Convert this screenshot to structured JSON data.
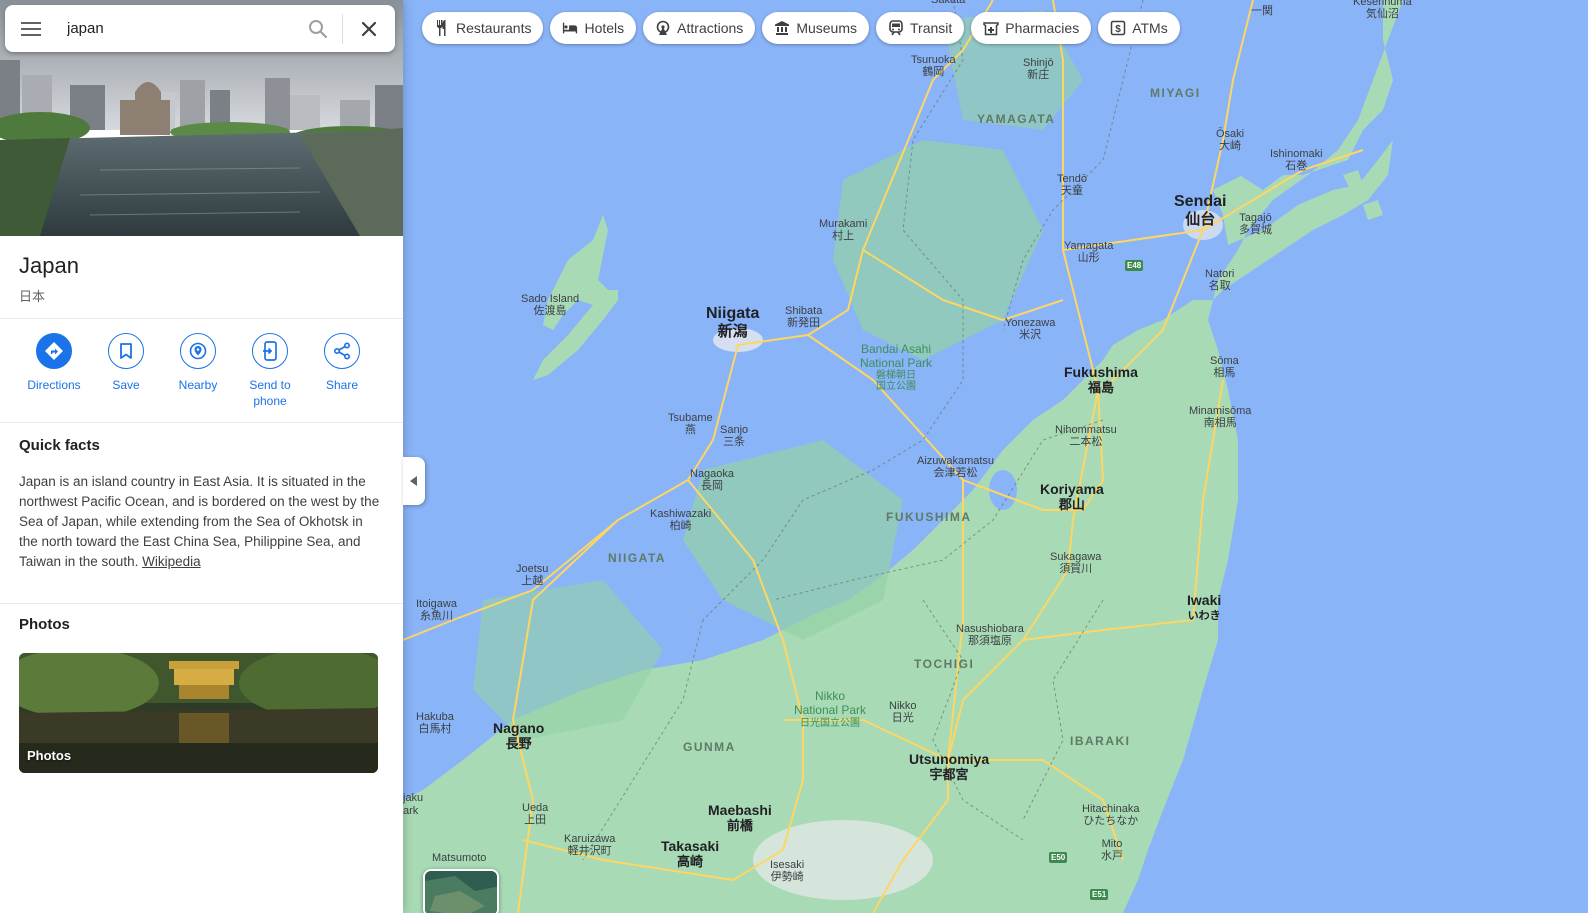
{
  "search": {
    "query": "japan"
  },
  "place": {
    "title": "Japan",
    "subtitle": "日本"
  },
  "actions": [
    {
      "label": "Directions",
      "icon": "directions-icon"
    },
    {
      "label": "Save",
      "icon": "bookmark-icon"
    },
    {
      "label": "Nearby",
      "icon": "nearby-icon"
    },
    {
      "label": "Send to phone",
      "icon": "send-to-phone-icon"
    },
    {
      "label": "Share",
      "icon": "share-icon"
    }
  ],
  "quick_facts": {
    "heading": "Quick facts",
    "text": "Japan is an island country in East Asia. It is situated in the northwest Pacific Ocean, and is bordered on the west by the Sea of Japan, while extending from the Sea of Okhotsk in the north toward the East China Sea, Philippine Sea, and Taiwan in the south.",
    "link": "Wikipedia"
  },
  "photos": {
    "heading": "Photos",
    "tile_label": "Photos"
  },
  "chips": [
    {
      "label": "Restaurants",
      "icon": "restaurant-icon"
    },
    {
      "label": "Hotels",
      "icon": "hotel-icon"
    },
    {
      "label": "Attractions",
      "icon": "attractions-icon"
    },
    {
      "label": "Museums",
      "icon": "museum-icon"
    },
    {
      "label": "Transit",
      "icon": "transit-icon"
    },
    {
      "label": "Pharmacies",
      "icon": "pharmacy-icon"
    },
    {
      "label": "ATMs",
      "icon": "atm-icon"
    }
  ],
  "map": {
    "colors": {
      "water": "#8ab4f8",
      "land": "#a8dab5",
      "land_dark": "#94d2a5",
      "road": "#fdd663",
      "urban": "#e8eaed"
    },
    "cities_major": [
      {
        "en": "Niigata",
        "ja": "新潟"
      },
      {
        "en": "Sendai",
        "ja": "仙台"
      },
      {
        "en": "Fukushima",
        "ja": "福島"
      },
      {
        "en": "Koriyama",
        "ja": "郡山"
      },
      {
        "en": "Utsunomiya",
        "ja": "宇都宮"
      },
      {
        "en": "Nagano",
        "ja": "長野"
      },
      {
        "en": "Maebashi",
        "ja": "前橋"
      },
      {
        "en": "Takasaki",
        "ja": "高崎"
      },
      {
        "en": "Iwaki",
        "ja": "いわき"
      }
    ],
    "cities_minor": [
      {
        "en": "Tsuruoka",
        "ja": "鶴岡"
      },
      {
        "en": "Shinjō",
        "ja": "新庄"
      },
      {
        "en": "Ōsaki",
        "ja": "大崎"
      },
      {
        "en": "Ishinomaki",
        "ja": "石巻"
      },
      {
        "en": "Tendō",
        "ja": "天童"
      },
      {
        "en": "Tagajō",
        "ja": "多賀城"
      },
      {
        "en": "Murakami",
        "ja": "村上"
      },
      {
        "en": "Yamagata",
        "ja": "山形"
      },
      {
        "en": "Natori",
        "ja": "名取"
      },
      {
        "en": "Sado Island",
        "ja": "佐渡島"
      },
      {
        "en": "Shibata",
        "ja": "新発田"
      },
      {
        "en": "Yonezawa",
        "ja": "米沢"
      },
      {
        "en": "Sōma",
        "ja": "相馬"
      },
      {
        "en": "Minamisōma",
        "ja": "南相馬"
      },
      {
        "en": "Tsubame",
        "ja": "燕"
      },
      {
        "en": "Sanjo",
        "ja": "三条"
      },
      {
        "en": "Nihommatsu",
        "ja": "二本松"
      },
      {
        "en": "Aizuwakamatsu",
        "ja": "会津若松"
      },
      {
        "en": "Nagaoka",
        "ja": "長岡"
      },
      {
        "en": "Kashiwazaki",
        "ja": "柏崎"
      },
      {
        "en": "Sukagawa",
        "ja": "須賀川"
      },
      {
        "en": "Joetsu",
        "ja": "上越"
      },
      {
        "en": "Itoigawa",
        "ja": "糸魚川"
      },
      {
        "en": "Nasushiobara",
        "ja": "那須塩原"
      },
      {
        "en": "Hakuba",
        "ja": "白馬村"
      },
      {
        "en": "Nikko",
        "ja": "日光"
      },
      {
        "en": "Ueda",
        "ja": "上田"
      },
      {
        "en": "Karuizawa",
        "ja": "軽井沢町"
      },
      {
        "en": "Hitachinaka",
        "ja": "ひたちなか"
      },
      {
        "en": "Mito",
        "ja": "水戸"
      },
      {
        "en": "Isesaki",
        "ja": "伊勢崎"
      },
      {
        "en": "Sakata",
        "ja": ""
      },
      {
        "en": "Kesennuma",
        "ja": "気仙沼"
      },
      {
        "en": "Matsumoto",
        "ja": ""
      }
    ],
    "regions": [
      "YAMAGATA",
      "MIYAGI",
      "NIIGATA",
      "FUKUSHIMA",
      "TOCHIGI",
      "GUNMA",
      "IBARAKI"
    ],
    "parks": [
      {
        "en1": "Bandai Asahi",
        "en2": "National Park",
        "ja": "磐梯朝日国立公園"
      },
      {
        "en1": "Nikko",
        "en2": "National Park",
        "ja": "日光国立公園"
      }
    ],
    "highway_shields": [
      "E48",
      "E50",
      "E51"
    ],
    "partial_labels": [
      "jaku",
      "ark",
      "一関"
    ]
  }
}
